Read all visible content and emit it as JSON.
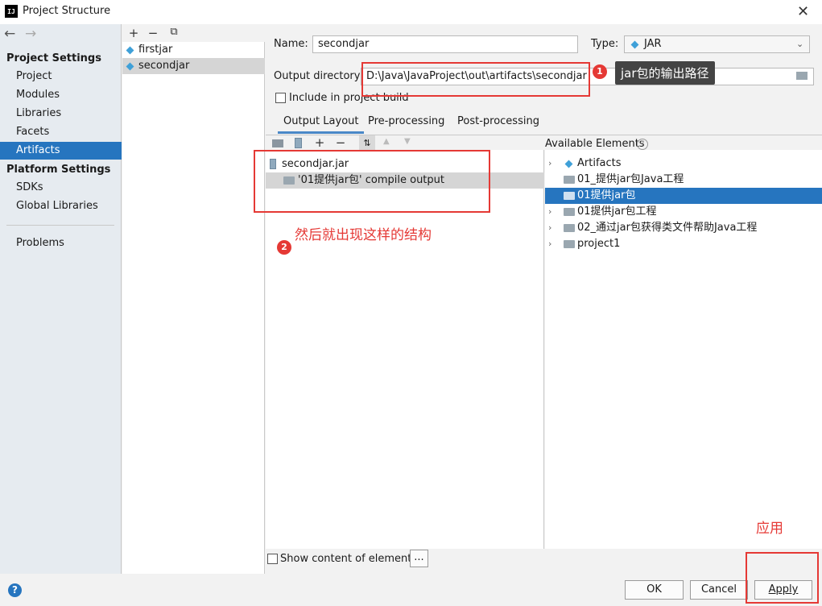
{
  "window": {
    "title": "Project Structure",
    "logo": "IJ",
    "close": "✕"
  },
  "sidebar": {
    "project_settings": "Project Settings",
    "items_project": [
      "Project",
      "Modules",
      "Libraries",
      "Facets",
      "Artifacts"
    ],
    "platform_settings": "Platform Settings",
    "items_platform": [
      "SDKs",
      "Global Libraries"
    ],
    "problems": "Problems",
    "selected": "Artifacts"
  },
  "artifacts": {
    "toolbar": {
      "add": "+",
      "remove": "−",
      "copy": "⧉"
    },
    "list": [
      "firstjar",
      "secondjar"
    ],
    "selected": "secondjar"
  },
  "form": {
    "name_label": "Name:",
    "name_value": "secondjar",
    "type_label": "Type:",
    "type_value": "JAR",
    "output_label": "Output directory:",
    "output_value": "D:\\Java\\JavaProject\\out\\artifacts\\secondjar",
    "include_label": "Include in project build"
  },
  "tabs": [
    "Output Layout",
    "Pre-processing",
    "Post-processing"
  ],
  "active_tab": "Output Layout",
  "available_label": "Available Elements",
  "layout_tree": [
    {
      "label": "secondjar.jar"
    },
    {
      "label": "'01提供jar包' compile output"
    }
  ],
  "available_tree": [
    "Artifacts",
    "01_提供jar包Java工程",
    "01提供jar包",
    "01提供jar包工程",
    "02_通过jar包获得类文件帮助Java工程",
    "project1"
  ],
  "show_content_label": "Show content of elements",
  "ellipsis_button": "...",
  "buttons": {
    "ok": "OK",
    "cancel": "Cancel",
    "apply": "Apply"
  },
  "annotations": {
    "badge1": "1",
    "callout1": "jar包的输出路径",
    "badge2": "2",
    "note2": "然后就出现这样的结构",
    "apply_note": "应用"
  },
  "colors": {
    "selection": "#2675bf",
    "annotation": "#e53935"
  }
}
